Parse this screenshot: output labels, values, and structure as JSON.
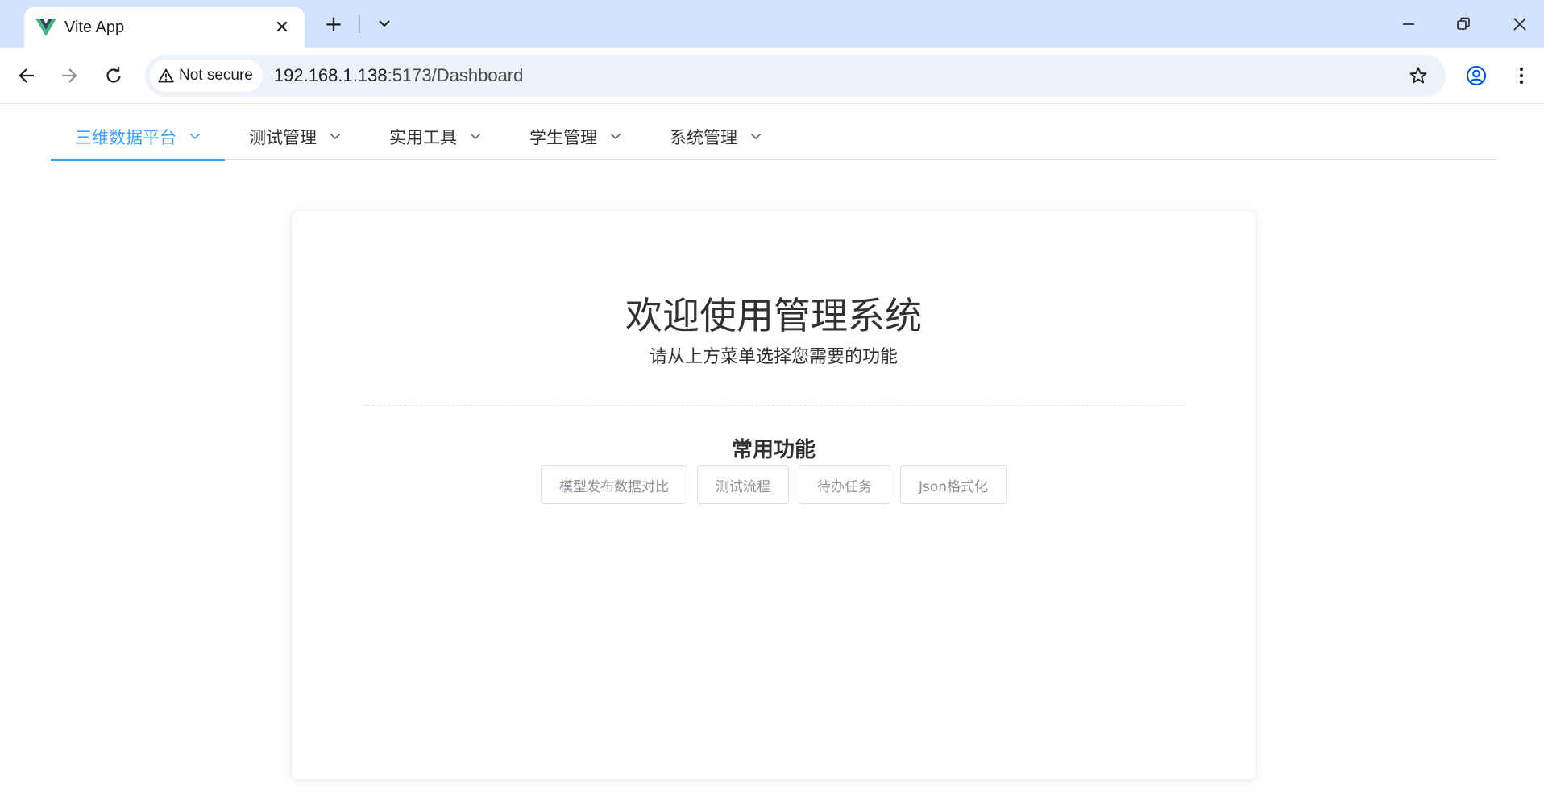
{
  "browser": {
    "tab_title": "Vite App",
    "tab_close": "✕",
    "new_tab": "+",
    "security_label": "Not secure",
    "url_host": "192.168.1.138",
    "url_path": ":5173/Dashboard"
  },
  "menu": {
    "items": [
      {
        "label": "三维数据平台",
        "active": true
      },
      {
        "label": "测试管理",
        "active": false
      },
      {
        "label": "实用工具",
        "active": false
      },
      {
        "label": "学生管理",
        "active": false
      },
      {
        "label": "系统管理",
        "active": false
      }
    ]
  },
  "dashboard": {
    "title": "欢迎使用管理系统",
    "subtitle": "请从上方菜单选择您需要的功能",
    "section_title": "常用功能",
    "quick_actions": [
      "模型发布数据对比",
      "测试流程",
      "待办任务",
      "Json格式化"
    ]
  },
  "colors": {
    "accent": "#409eff",
    "tabstrip": "#d3e3fd",
    "omnibox": "#edf2fa",
    "vue_green": "#41b883",
    "vue_dark": "#35495e"
  }
}
